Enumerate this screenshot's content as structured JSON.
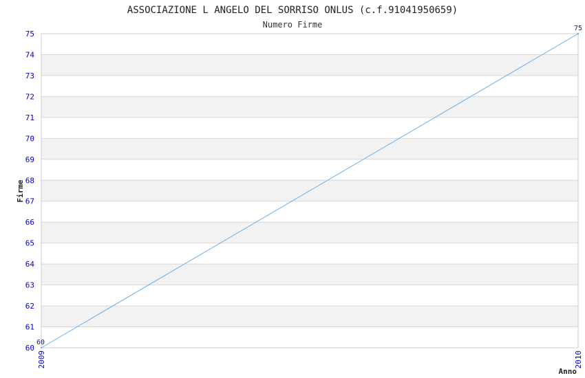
{
  "chart_data": {
    "type": "line",
    "title": "ASSOCIAZIONE L ANGELO DEL SORRISO ONLUS (c.f.91041950659)",
    "subtitle": "Numero Firme",
    "xlabel": "Anno",
    "ylabel": "Firme",
    "categories": [
      "2009",
      "2010"
    ],
    "series": [
      {
        "values": [
          60,
          75
        ]
      }
    ],
    "data_labels": [
      "60",
      "75"
    ],
    "ylim": [
      60,
      75
    ],
    "yticks": [
      60,
      61,
      62,
      63,
      64,
      65,
      66,
      67,
      68,
      69,
      70,
      71,
      72,
      73,
      74,
      75
    ],
    "grid": true,
    "colors": {
      "line": "#6aaee8",
      "band": "#f2f2f2",
      "grid": "#d8d8d8",
      "tick_text": "#0000cc"
    }
  }
}
